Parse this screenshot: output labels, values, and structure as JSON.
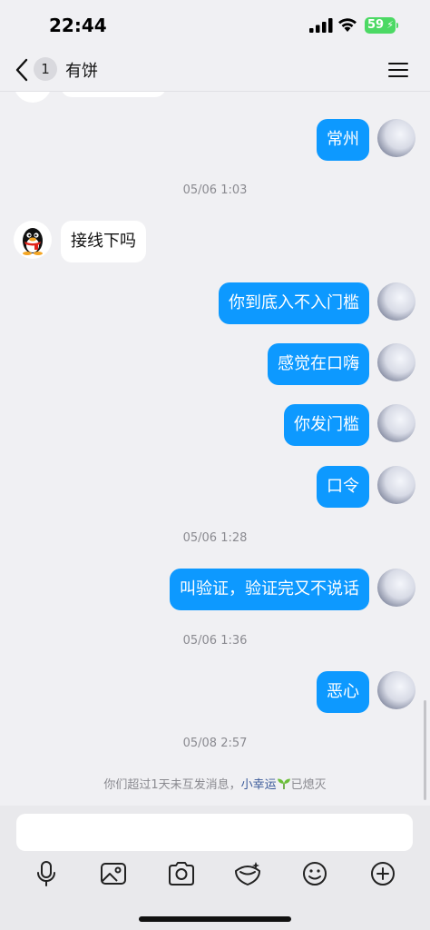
{
  "status_bar": {
    "time": "22:44",
    "battery": "59"
  },
  "nav": {
    "unread_count": "1",
    "title": "有饼"
  },
  "messages": [
    {
      "text": "常州"
    },
    {
      "timestamp": "05/06 1:03"
    },
    {
      "text": "接线下吗"
    },
    {
      "text": "你到底入不入门槛"
    },
    {
      "text": "感觉在口嗨"
    },
    {
      "text": "你发门槛"
    },
    {
      "text": "口令"
    },
    {
      "timestamp": "05/06 1:28"
    },
    {
      "text": "叫验证，验证完又不说话"
    },
    {
      "timestamp": "05/06 1:36"
    },
    {
      "text": "恶心"
    },
    {
      "timestamp": "05/08 2:57"
    }
  ],
  "notice": {
    "prefix": "你们超过1天未互发消息，",
    "highlight": "小幸运",
    "suffix": "已熄灭"
  },
  "colors": {
    "outgoing_bubble": "#0d99ff",
    "background": "#f0f0f3",
    "battery": "#4cd964"
  },
  "toolbar": {
    "icons": [
      "microphone-icon",
      "image-icon",
      "camera-icon",
      "red-packet-icon",
      "emoji-icon",
      "plus-icon"
    ]
  }
}
